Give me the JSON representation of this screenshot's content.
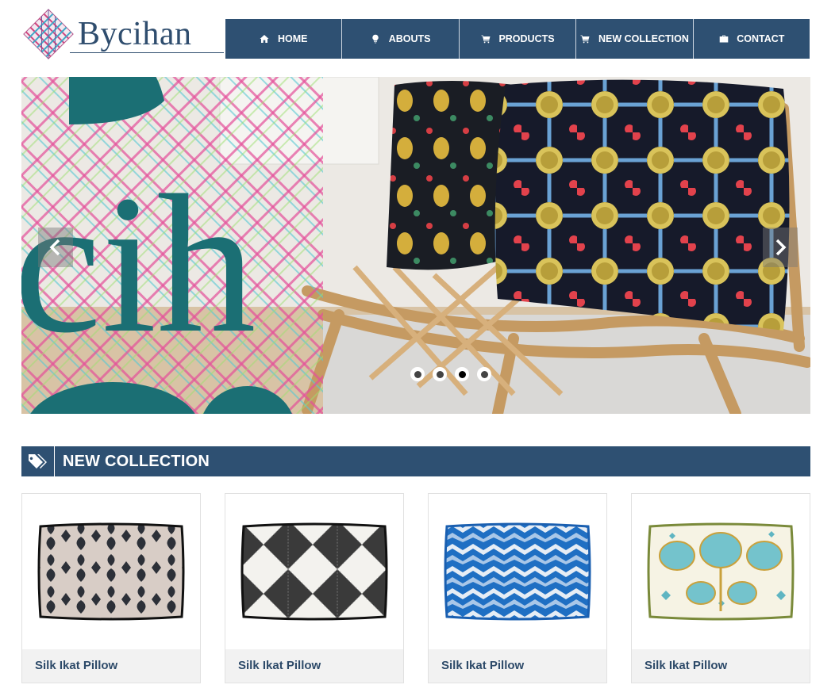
{
  "brand": {
    "logo_text": "Bycihan"
  },
  "nav": {
    "items": [
      {
        "label": "HOME",
        "icon": "home-icon"
      },
      {
        "label": "ABOUTS",
        "icon": "lightbulb-icon"
      },
      {
        "label": "PRODUCTS",
        "icon": "cart-icon"
      },
      {
        "label": "NEW COLLECTION",
        "icon": "cart-icon"
      },
      {
        "label": "CONTACT",
        "icon": "briefcase-icon"
      }
    ]
  },
  "slider": {
    "slide_count": 4,
    "active_slide": 3,
    "overlay_text": "cih"
  },
  "section": {
    "title": "NEW COLLECTION",
    "icon": "tags-icon"
  },
  "products": [
    {
      "name": "Silk Ikat Pillow",
      "pattern": "ikat-black",
      "colors": [
        "#d6cbc5",
        "#2b2f36"
      ]
    },
    {
      "name": "Silk Ikat Pillow",
      "pattern": "diamond-black",
      "colors": [
        "#f4f3ef",
        "#303030"
      ]
    },
    {
      "name": "Silk Ikat Pillow",
      "pattern": "chevron-blue",
      "colors": [
        "#1e6fc2",
        "#e8eef5"
      ]
    },
    {
      "name": "Silk Ikat Pillow",
      "pattern": "floral-teal",
      "colors": [
        "#f6f3e6",
        "#6fbfc9"
      ]
    }
  ],
  "colors": {
    "nav_bg": "#2e5072",
    "accent_teal": "#1f6e72",
    "text": "#2d4a69"
  }
}
